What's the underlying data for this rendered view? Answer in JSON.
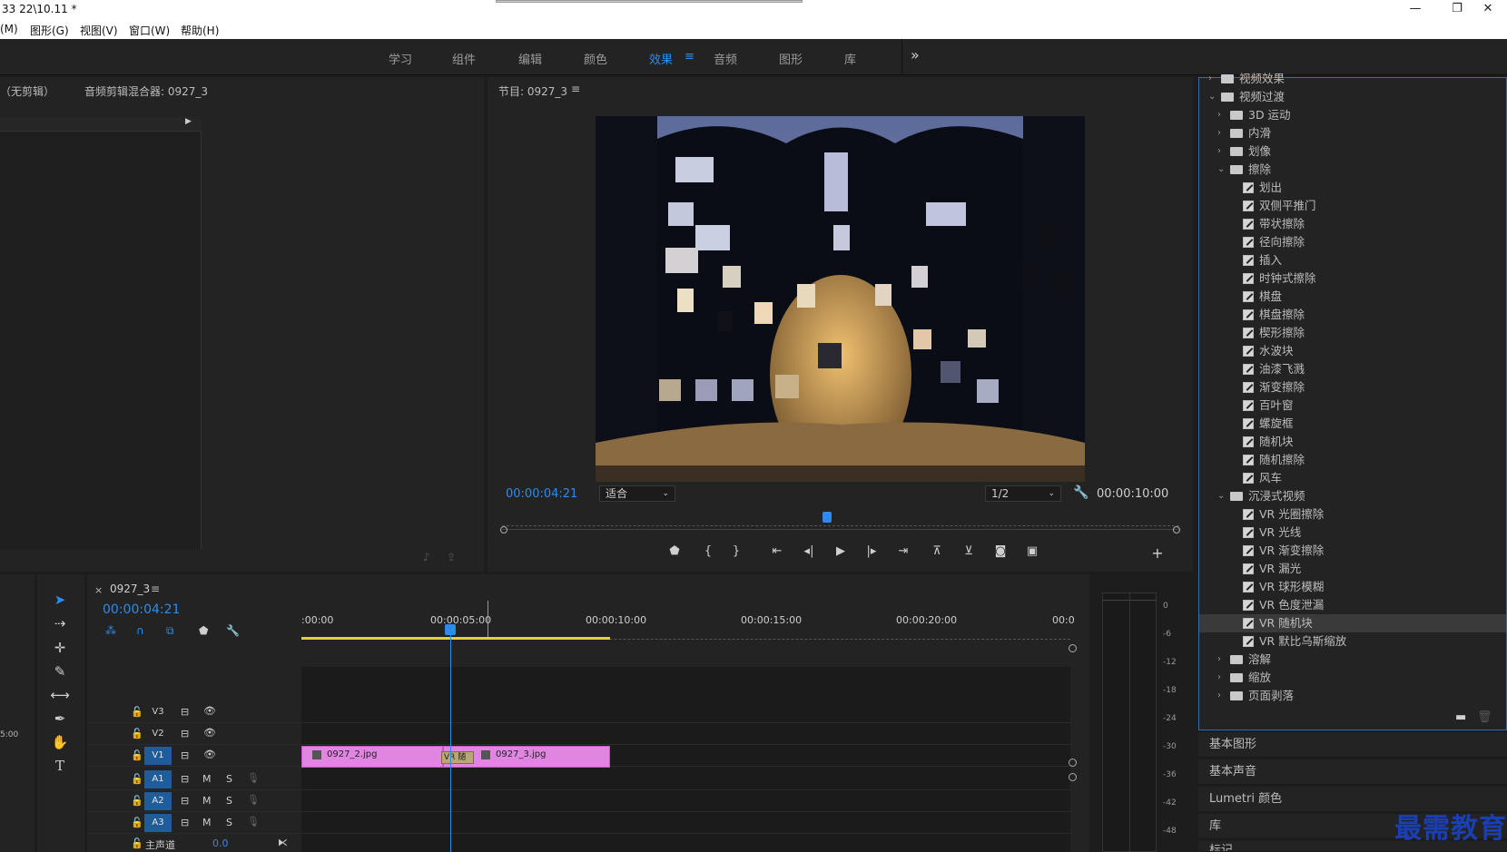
{
  "window": {
    "title": "33 22\\10.11 *",
    "menus": [
      "(M)",
      "图形(G)",
      "视图(V)",
      "窗口(W)",
      "帮助(H)"
    ]
  },
  "workspaces": {
    "items": [
      "学习",
      "组件",
      "编辑",
      "颜色",
      "效果",
      "音频",
      "图形",
      "库"
    ],
    "active": "效果",
    "menu_icon": "≡",
    "more": "»"
  },
  "source_panel": {
    "tab1": "（无剪辑）",
    "tab2": "音频剪辑混合器: 0927_3"
  },
  "program_panel": {
    "title": "节目: 0927_3",
    "menu_icon": "≡",
    "current_time": "00:00:04:21",
    "zoom": "适合",
    "resolution": "1/2",
    "duration": "00:00:10:00"
  },
  "effects": {
    "items": [
      {
        "label": "视频效果",
        "type": "folder",
        "level": 0,
        "open": false
      },
      {
        "label": "视频过渡",
        "type": "folder",
        "level": 0,
        "open": true
      },
      {
        "label": "3D 运动",
        "type": "folder",
        "level": 1,
        "open": false
      },
      {
        "label": "内滑",
        "type": "folder",
        "level": 1,
        "open": false
      },
      {
        "label": "划像",
        "type": "folder",
        "level": 1,
        "open": false
      },
      {
        "label": "擦除",
        "type": "folder",
        "level": 1,
        "open": true
      },
      {
        "label": "划出",
        "type": "effect",
        "level": 2
      },
      {
        "label": "双侧平推门",
        "type": "effect",
        "level": 2
      },
      {
        "label": "带状擦除",
        "type": "effect",
        "level": 2
      },
      {
        "label": "径向擦除",
        "type": "effect",
        "level": 2
      },
      {
        "label": "插入",
        "type": "effect",
        "level": 2
      },
      {
        "label": "时钟式擦除",
        "type": "effect",
        "level": 2
      },
      {
        "label": "棋盘",
        "type": "effect",
        "level": 2
      },
      {
        "label": "棋盘擦除",
        "type": "effect",
        "level": 2
      },
      {
        "label": "楔形擦除",
        "type": "effect",
        "level": 2
      },
      {
        "label": "水波块",
        "type": "effect",
        "level": 2
      },
      {
        "label": "油漆飞溅",
        "type": "effect",
        "level": 2
      },
      {
        "label": "渐变擦除",
        "type": "effect",
        "level": 2
      },
      {
        "label": "百叶窗",
        "type": "effect",
        "level": 2
      },
      {
        "label": "螺旋框",
        "type": "effect",
        "level": 2
      },
      {
        "label": "随机块",
        "type": "effect",
        "level": 2
      },
      {
        "label": "随机擦除",
        "type": "effect",
        "level": 2
      },
      {
        "label": "风车",
        "type": "effect",
        "level": 2
      },
      {
        "label": "沉浸式视频",
        "type": "folder",
        "level": 1,
        "open": true
      },
      {
        "label": "VR 光圈擦除",
        "type": "effect",
        "level": 2
      },
      {
        "label": "VR 光线",
        "type": "effect",
        "level": 2
      },
      {
        "label": "VR 渐变擦除",
        "type": "effect",
        "level": 2
      },
      {
        "label": "VR 漏光",
        "type": "effect",
        "level": 2
      },
      {
        "label": "VR 球形模糊",
        "type": "effect",
        "level": 2
      },
      {
        "label": "VR 色度泄漏",
        "type": "effect",
        "level": 2
      },
      {
        "label": "VR 随机块",
        "type": "effect",
        "level": 2,
        "selected": true
      },
      {
        "label": "VR 默比乌斯缩放",
        "type": "effect",
        "level": 2
      },
      {
        "label": "溶解",
        "type": "folder",
        "level": 1,
        "open": false
      },
      {
        "label": "缩放",
        "type": "folder",
        "level": 1,
        "open": false
      },
      {
        "label": "页面剥落",
        "type": "folder",
        "level": 1,
        "open": false
      }
    ]
  },
  "side_panels": [
    "基本图形",
    "基本声音",
    "Lumetri 颜色",
    "库",
    "标记"
  ],
  "timeline": {
    "close": "×",
    "sequence": "0927_3",
    "menu_icon": "≡",
    "current_time": "00:00:04:21",
    "ruler": [
      ":00:00",
      "00:00:05:00",
      "00:00:10:00",
      "00:00:15:00",
      "00:00:20:00",
      "00:0"
    ],
    "tracks": [
      {
        "name": "V3",
        "kind": "video",
        "on": false
      },
      {
        "name": "V2",
        "kind": "video",
        "on": false
      },
      {
        "name": "V1",
        "kind": "video",
        "on": true
      },
      {
        "name": "A1",
        "kind": "audio",
        "on": true
      },
      {
        "name": "A2",
        "kind": "audio",
        "on": true
      },
      {
        "name": "A3",
        "kind": "audio",
        "on": true
      }
    ],
    "master_label": "主声道",
    "master_value": "0.0",
    "clips": [
      {
        "label": "0927_2.jpg"
      },
      {
        "label": "0927_3.jpg"
      }
    ],
    "transition_label": "VR 随机"
  },
  "left_strip_time": "5:00",
  "meter_labels": [
    "0",
    "-6",
    "-12",
    "-18",
    "-24",
    "-30",
    "-36",
    "-42",
    "-48"
  ],
  "watermark": "最需教育"
}
